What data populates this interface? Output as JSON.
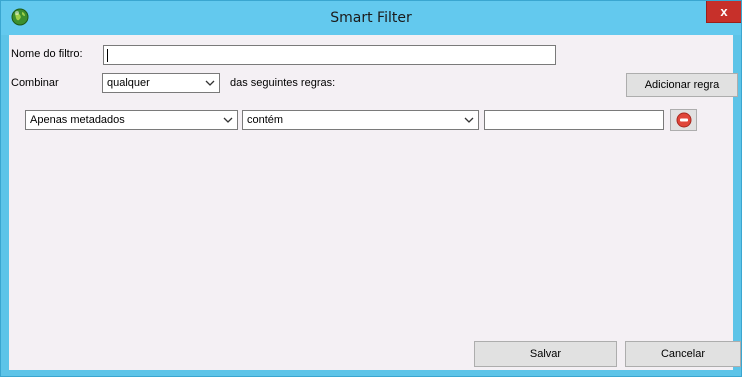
{
  "window": {
    "title": "Smart Filter",
    "close_label": "x"
  },
  "filter_name": {
    "label": "Nome do filtro:",
    "value": ""
  },
  "combine": {
    "label": "Combinar",
    "selected": "qualquer",
    "suffix": "das seguintes regras:"
  },
  "add_rule_button": "Adicionar regra",
  "rules": [
    {
      "field": "Apenas metadados",
      "operator": "contém",
      "value": ""
    }
  ],
  "footer": {
    "save_label": "Salvar",
    "cancel_label": "Cancelar"
  },
  "colors": {
    "titlebar": "#63c9ee",
    "close": "#c7302a",
    "client_bg": "#f4f0f4",
    "remove_icon": "#e0463a"
  },
  "icons": {
    "app": "globe-icon",
    "remove": "minus-circle-icon",
    "dropdown": "chevron-down-icon"
  }
}
